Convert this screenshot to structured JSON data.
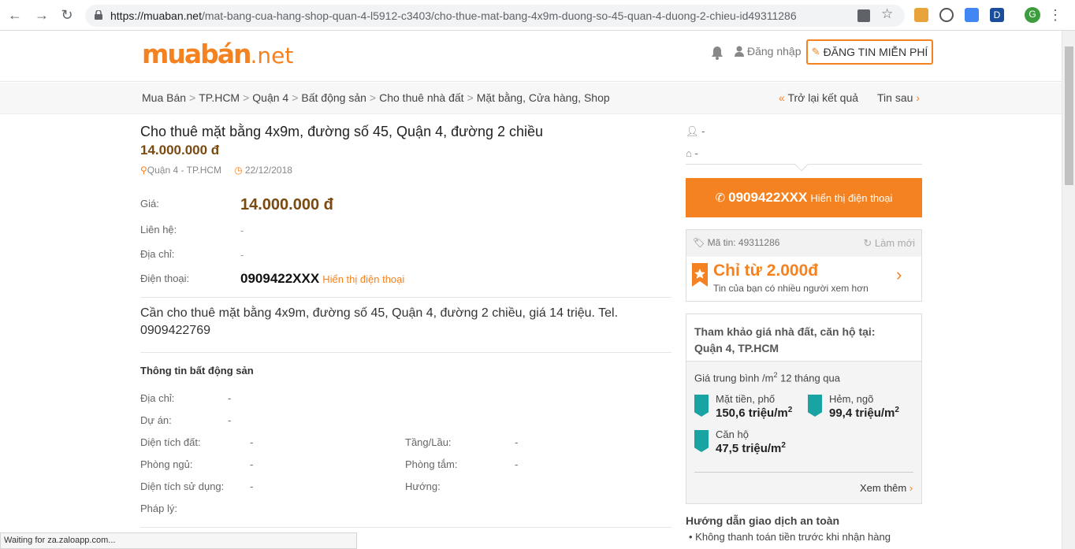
{
  "browser": {
    "url_host": "https://muaban.net",
    "url_path": "/mat-bang-cua-hang-shop-quan-4-l5912-c3403/cho-thue-mat-bang-4x9m-duong-so-45-quan-4-duong-2-chieu-id49311286",
    "profile_initial": "G",
    "ext_d": "D",
    "status": "Waiting for za.zaloapp.com..."
  },
  "header": {
    "logo_main": "muabán",
    "logo_net": ".net",
    "login": "Đăng nhập",
    "post_button": "ĐĂNG TIN MIỄN PHÍ"
  },
  "breadcrumb": {
    "items": [
      "Mua Bán",
      "TP.HCM",
      "Quận 4",
      "Bất động sản",
      "Cho thuê nhà đất",
      "Mặt bằng, Cửa hàng, Shop"
    ],
    "back": "Trở lại kết quả",
    "next": "Tin sau"
  },
  "listing": {
    "title": "Cho thuê mặt bằng 4x9m, đường số 45, Quận 4, đường 2 chiều",
    "price": "14.000.000 đ",
    "location": "Quận 4 - TP.HCM",
    "date": "22/12/2018",
    "labels": {
      "price": "Giá:",
      "contact": "Liên hệ:",
      "address": "Địa chỉ:",
      "phone": "Điện thoại:"
    },
    "contact_value": "-",
    "address_value": "-",
    "phone": "0909422XXX",
    "show_phone": "Hiển thị điện thoại",
    "description": "Cần cho thuê mặt bằng 4x9m, đường số 45, Quận 4, đường 2 chiều, giá 14 triệu. Tel. 0909422769"
  },
  "property": {
    "section_title": "Thông tin bất động sản",
    "address_label": "Địa chỉ:",
    "address_value": "-",
    "project_label": "Dự án:",
    "project_value": "-",
    "land_label": "Diện tích đất:",
    "land_value": "-",
    "floor_label": "Tầng/Lầu:",
    "floor_value": "-",
    "bed_label": "Phòng ngủ:",
    "bed_value": "-",
    "bath_label": "Phòng tắm:",
    "bath_value": "-",
    "use_label": "Diện tích sử dụng:",
    "use_value": "-",
    "dir_label": "Hướng:",
    "legal_label": "Pháp lý:"
  },
  "sidebar": {
    "user": "-",
    "home": "-",
    "call_number": "0909422XXX",
    "call_label": "Hiển thị điện thoại",
    "promo_id": "Mã tin: 49311286",
    "promo_refresh": "Làm mới",
    "promo_big": "Chỉ từ 2.000đ",
    "promo_sub": "Tin của bạn có nhiều người xem hơn",
    "ref_title": "Tham khảo giá nhà đất, căn hộ tại:",
    "ref_place": "Quận 4, TP.HCM",
    "ref_avg": "Giá trung bình /m",
    "ref_avg_sup": "2",
    "ref_avg_tail": " 12 tháng qua",
    "street_label": "Mặt tiền, phố",
    "street_value": "150,6 triệu/m",
    "alley_label": "Hẻm, ngõ",
    "alley_value": "99,4 triệu/m",
    "apt_label": "Căn hộ",
    "apt_value": "47,5 triệu/m",
    "sup": "2",
    "more": "Xem thêm",
    "guide_title": "Hướng dẫn giao dịch an toàn",
    "guide_item": "Không thanh toán tiền trước khi nhận hàng"
  },
  "colors": {
    "accent": "#f58220",
    "price": "#7a4a10",
    "teal": "#1aa3a3"
  }
}
